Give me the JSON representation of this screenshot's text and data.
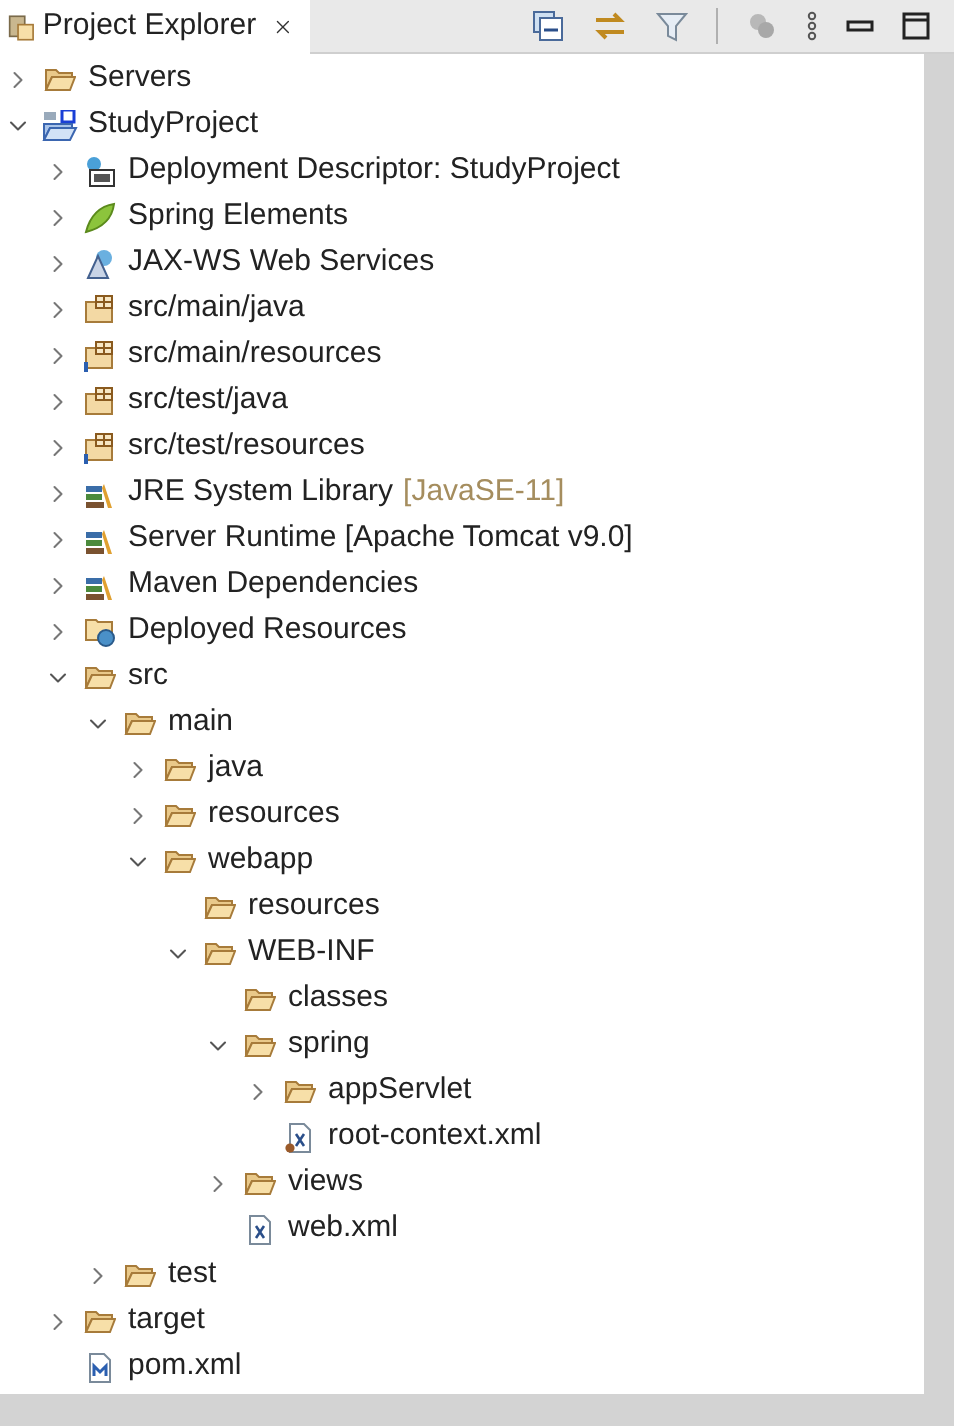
{
  "tab": {
    "title": "Project Explorer",
    "selected": true
  },
  "tree": [
    {
      "label": "Servers",
      "kind": "folder-open",
      "expanded": false
    },
    {
      "label": "StudyProject",
      "kind": "project",
      "expanded": true,
      "children": [
        {
          "label": "Deployment Descriptor: StudyProject",
          "kind": "descriptor",
          "expanded": false
        },
        {
          "label": "Spring Elements",
          "kind": "spring",
          "expanded": false
        },
        {
          "label": "JAX-WS Web Services",
          "kind": "webservice",
          "expanded": false
        },
        {
          "label": "src/main/java",
          "kind": "package",
          "expanded": false
        },
        {
          "label": "src/main/resources",
          "kind": "resource-package",
          "expanded": false
        },
        {
          "label": "src/test/java",
          "kind": "package",
          "expanded": false
        },
        {
          "label": "src/test/resources",
          "kind": "resource-package",
          "expanded": false
        },
        {
          "label": "JRE System Library",
          "decoration": "[JavaSE-11]",
          "kind": "library",
          "expanded": false
        },
        {
          "label": "Server Runtime [Apache Tomcat v9.0]",
          "kind": "library",
          "expanded": false
        },
        {
          "label": "Maven Dependencies",
          "kind": "library",
          "expanded": false
        },
        {
          "label": "Deployed Resources",
          "kind": "deployed",
          "expanded": false
        },
        {
          "label": "src",
          "kind": "folder",
          "expanded": true,
          "children": [
            {
              "label": "main",
              "kind": "folder",
              "expanded": true,
              "children": [
                {
                  "label": "java",
                  "kind": "folder",
                  "expanded": false
                },
                {
                  "label": "resources",
                  "kind": "folder",
                  "expanded": false
                },
                {
                  "label": "webapp",
                  "kind": "folder",
                  "expanded": true,
                  "children": [
                    {
                      "label": "resources",
                      "kind": "folder"
                    },
                    {
                      "label": "WEB-INF",
                      "kind": "folder",
                      "expanded": true,
                      "children": [
                        {
                          "label": "classes",
                          "kind": "folder"
                        },
                        {
                          "label": "spring",
                          "kind": "folder",
                          "expanded": true,
                          "children": [
                            {
                              "label": "appServlet",
                              "kind": "folder",
                              "expanded": false
                            },
                            {
                              "label": "root-context.xml",
                              "kind": "spring-xml"
                            }
                          ]
                        },
                        {
                          "label": "views",
                          "kind": "folder",
                          "expanded": false
                        },
                        {
                          "label": "web.xml",
                          "kind": "xml"
                        }
                      ]
                    }
                  ]
                }
              ]
            },
            {
              "label": "test",
              "kind": "folder",
              "expanded": false
            }
          ]
        },
        {
          "label": "target",
          "kind": "folder",
          "expanded": false
        },
        {
          "label": "pom.xml",
          "kind": "maven-file"
        }
      ]
    }
  ]
}
